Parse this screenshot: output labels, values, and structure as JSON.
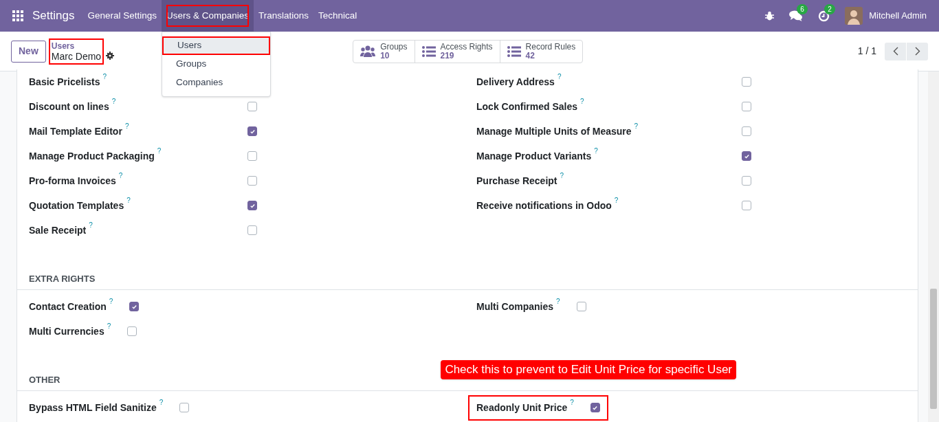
{
  "topbar": {
    "app": "Settings",
    "menus": [
      {
        "label": "General Settings",
        "selected": false,
        "highlighted": false
      },
      {
        "label": "Users & Companies",
        "selected": true,
        "highlighted": true
      },
      {
        "label": "Translations",
        "selected": false,
        "highlighted": false
      },
      {
        "label": "Technical",
        "selected": false,
        "highlighted": false
      }
    ],
    "messages_badge": "6",
    "activities_badge": "2",
    "user": "Mitchell Admin"
  },
  "dropdown": {
    "items": [
      {
        "label": "Users",
        "selected": true,
        "highlighted": true
      },
      {
        "label": "Groups",
        "selected": false,
        "highlighted": false
      },
      {
        "label": "Companies",
        "selected": false,
        "highlighted": false
      }
    ]
  },
  "control_panel": {
    "new_button": "New",
    "breadcrumb": {
      "parent": "Users",
      "current": "Marc Demo",
      "highlighted": true
    },
    "stat_buttons": [
      {
        "kind": "groups",
        "label": "Groups",
        "value": "10"
      },
      {
        "kind": "list",
        "label": "Access Rights",
        "value": "219"
      },
      {
        "kind": "list",
        "label": "Record Rules",
        "value": "42"
      }
    ],
    "pager": "1 / 1"
  },
  "sections": [
    {
      "kind": "aligned",
      "columns": [
        [
          {
            "label": "Basic Pricelists",
            "help": "?",
            "highlighted": false
          },
          {
            "label": "Discount on lines",
            "help": "?",
            "checked": false,
            "highlighted": false
          },
          {
            "label": "Mail Template Editor",
            "help": "?",
            "checked": true,
            "highlighted": false
          },
          {
            "label": "Manage Product Packaging",
            "help": "?",
            "checked": false,
            "highlighted": false
          },
          {
            "label": "Pro-forma Invoices",
            "help": "?",
            "checked": false,
            "highlighted": false
          },
          {
            "label": "Quotation Templates",
            "help": "?",
            "checked": true,
            "highlighted": false
          },
          {
            "label": "Sale Receipt",
            "help": "?",
            "checked": false,
            "highlighted": false
          }
        ],
        [
          {
            "label": "Delivery Address",
            "help": "?",
            "checked": false,
            "highlighted": false
          },
          {
            "label": "Lock Confirmed Sales",
            "help": "?",
            "checked": false,
            "highlighted": false
          },
          {
            "label": "Manage Multiple Units of Measure",
            "help": "?",
            "checked": false,
            "highlighted": false
          },
          {
            "label": "Manage Product Variants",
            "help": "?",
            "checked": true,
            "highlighted": false
          },
          {
            "label": "Purchase Receipt",
            "help": "?",
            "checked": false,
            "highlighted": false
          },
          {
            "label": "Receive notifications in Odoo",
            "help": "?",
            "checked": false,
            "highlighted": false
          }
        ]
      ]
    },
    {
      "kind": "inline",
      "title": "EXTRA RIGHTS",
      "columns": [
        [
          {
            "label": "Contact Creation",
            "help": "?",
            "checked": true,
            "highlighted": false
          },
          {
            "label": "Multi Currencies",
            "help": "?",
            "checked": false,
            "highlighted": false
          }
        ],
        [
          {
            "label": "Multi Companies",
            "help": "?",
            "checked": false,
            "highlighted": false
          }
        ]
      ]
    },
    {
      "kind": "inline",
      "title": "OTHER",
      "callout": "Check this to prevent to Edit Unit Price for specific User",
      "columns": [
        [
          {
            "label": "Bypass HTML Field Sanitize",
            "help": "?",
            "checked": false,
            "highlighted": false
          }
        ],
        [
          {
            "label": "Readonly Unit Price",
            "help": "?",
            "checked": true,
            "highlighted": true
          }
        ]
      ]
    }
  ]
}
